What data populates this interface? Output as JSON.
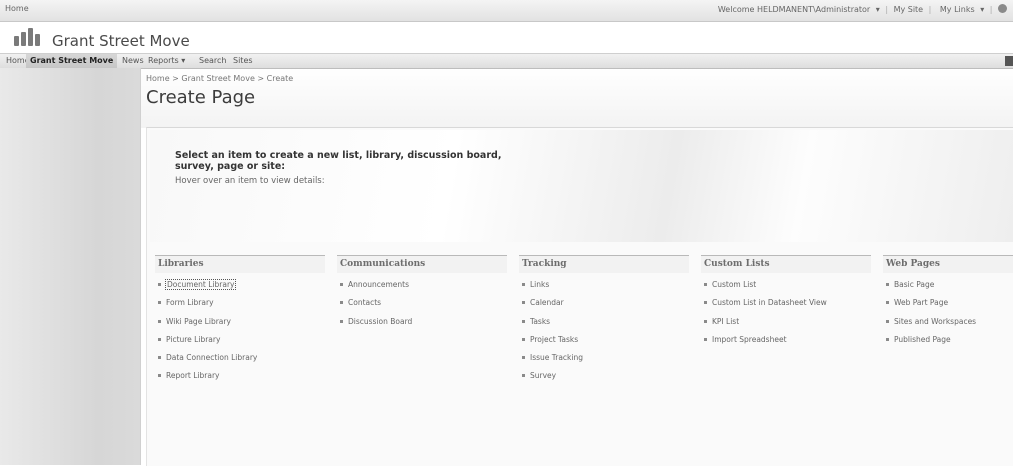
{
  "top": {
    "home_link": "Home",
    "welcome": "Welcome HELDMANENT\\Administrator",
    "my_site": "My Site",
    "my_links": "My Links",
    "separator": "|"
  },
  "site": {
    "title": "Grant Street Move"
  },
  "nav": {
    "tabs": [
      "Home",
      "Grant Street Move",
      "News",
      "Reports",
      "Search",
      "Sites"
    ],
    "active_tab": "Grant Street Move"
  },
  "breadcrumb": "Home > Grant Street Move > Create",
  "page_title": "Create Page",
  "instructions": {
    "title": "Select an item to create a new list, library, discussion board, survey, page or site:",
    "hint": "Hover over an item to view details:"
  },
  "columns": [
    {
      "header": "Libraries",
      "items": [
        "Document Library",
        "Form Library",
        "Wiki Page Library",
        "Picture Library",
        "Data Connection Library",
        "Report Library"
      ]
    },
    {
      "header": "Communications",
      "items": [
        "Announcements",
        "Contacts",
        "Discussion Board"
      ]
    },
    {
      "header": "Tracking",
      "items": [
        "Links",
        "Calendar",
        "Tasks",
        "Project Tasks",
        "Issue Tracking",
        "Survey"
      ]
    },
    {
      "header": "Custom Lists",
      "items": [
        "Custom List",
        "Custom List in Datasheet View",
        "KPI List",
        "Import Spreadsheet"
      ]
    },
    {
      "header": "Web Pages",
      "items": [
        "Basic Page",
        "Web Part Page",
        "Sites and Workspaces",
        "Published Page"
      ]
    }
  ],
  "icons": {
    "dropdown": "dropdown-arrow-icon",
    "help": "help-icon",
    "logo": "site-logo-icon"
  }
}
